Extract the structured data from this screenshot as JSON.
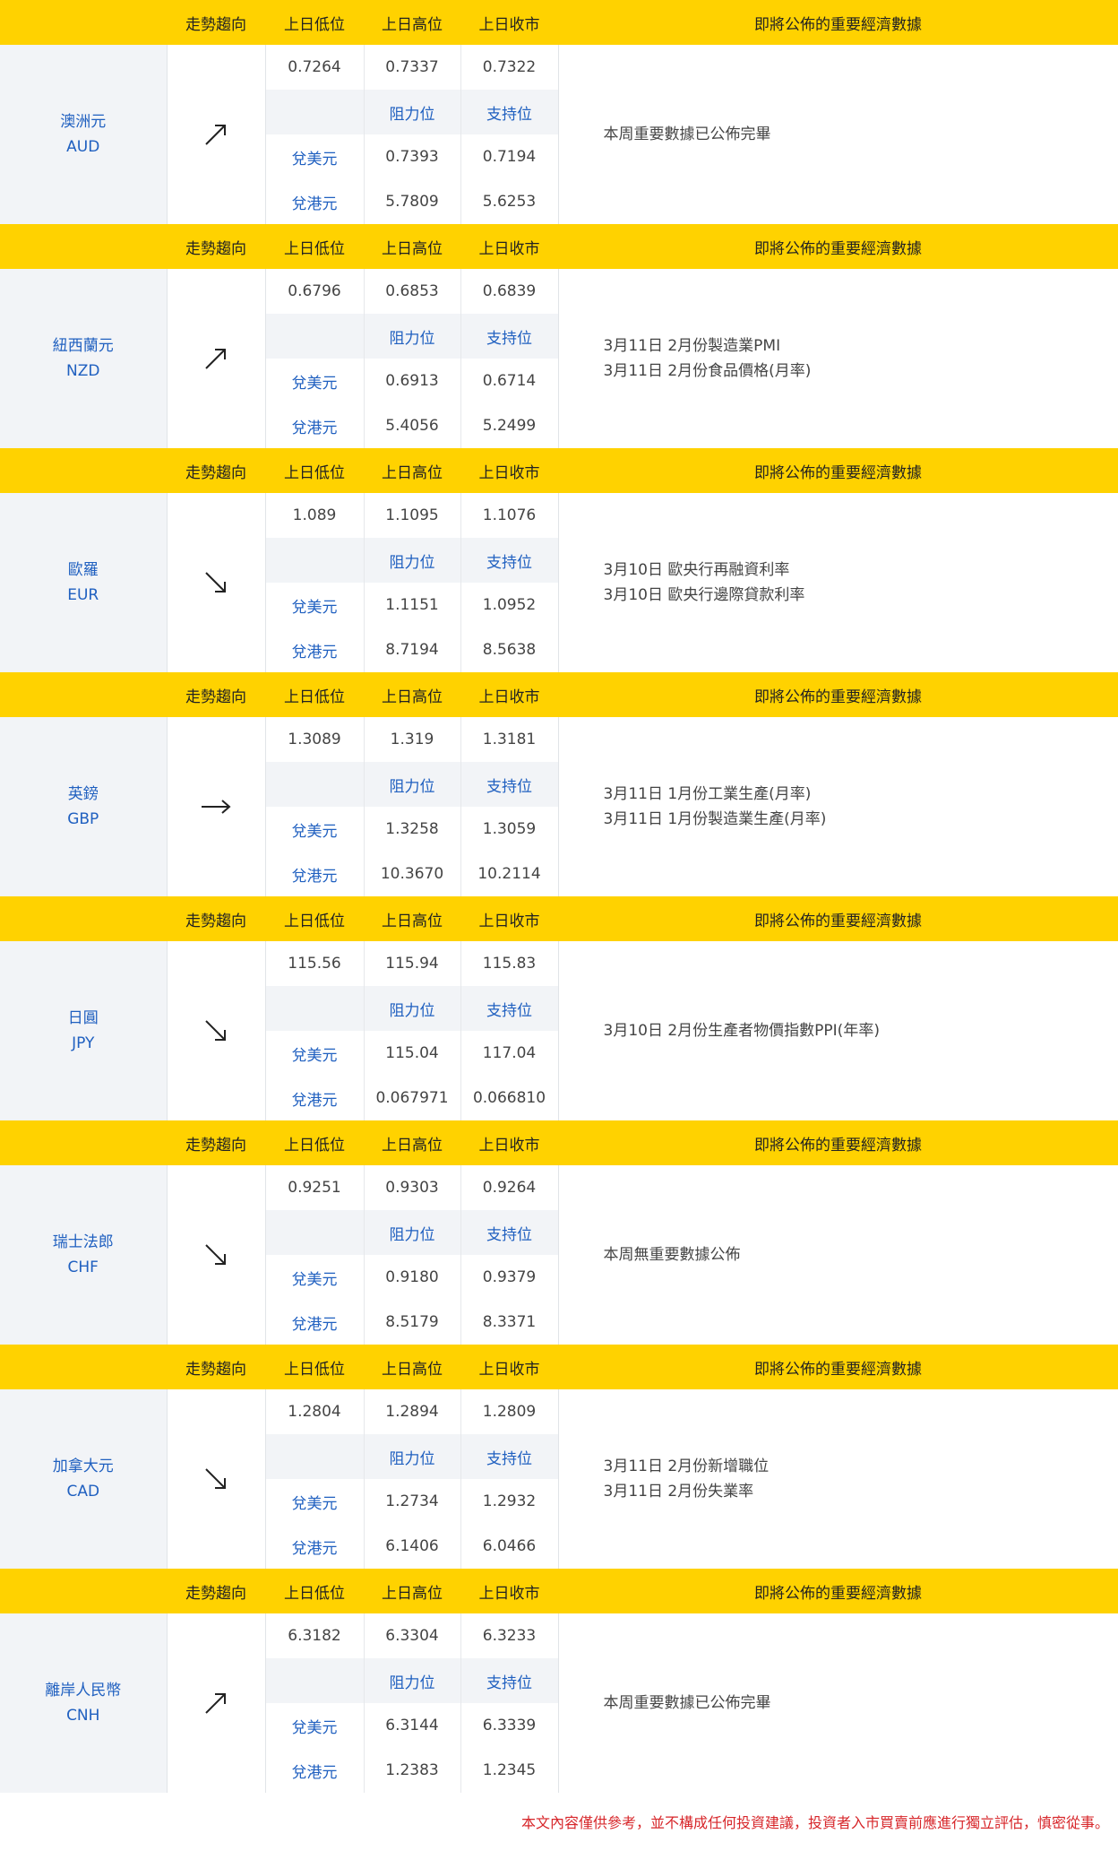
{
  "header": {
    "trend": "走勢趨向",
    "prev_low": "上日低位",
    "prev_high": "上日高位",
    "prev_close": "上日收市",
    "news": "即將公佈的重要經濟數據"
  },
  "sub_header": {
    "resistance": "阻力位",
    "support": "支持位"
  },
  "labels": {
    "vs_usd": "兌美元",
    "vs_hkd": "兌港元"
  },
  "currencies": [
    {
      "name": "澳洲元",
      "code": "AUD",
      "trend_icon": "arrow-up-right-icon",
      "prev_low": "0.7264",
      "prev_high": "0.7337",
      "prev_close": "0.7322",
      "usd_resistance": "0.7393",
      "usd_support": "0.7194",
      "hkd_resistance": "5.7809",
      "hkd_support": "5.6253",
      "news": [
        "本周重要數據已公佈完畢"
      ]
    },
    {
      "name": "紐西蘭元",
      "code": "NZD",
      "trend_icon": "arrow-up-right-icon",
      "prev_low": "0.6796",
      "prev_high": "0.6853",
      "prev_close": "0.6839",
      "usd_resistance": "0.6913",
      "usd_support": "0.6714",
      "hkd_resistance": "5.4056",
      "hkd_support": "5.2499",
      "news": [
        "3月11日 2月份製造業PMI",
        "3月11日 2月份食品價格(月率)"
      ]
    },
    {
      "name": "歐羅",
      "code": "EUR",
      "trend_icon": "arrow-down-right-icon",
      "prev_low": "1.089",
      "prev_high": "1.1095",
      "prev_close": "1.1076",
      "usd_resistance": "1.1151",
      "usd_support": "1.0952",
      "hkd_resistance": "8.7194",
      "hkd_support": "8.5638",
      "news": [
        "3月10日 歐央行再融資利率",
        "3月10日 歐央行邊際貸款利率"
      ]
    },
    {
      "name": "英鎊",
      "code": "GBP",
      "trend_icon": "arrow-right-icon",
      "prev_low": "1.3089",
      "prev_high": "1.319",
      "prev_close": "1.3181",
      "usd_resistance": "1.3258",
      "usd_support": "1.3059",
      "hkd_resistance": "10.3670",
      "hkd_support": "10.2114",
      "news": [
        "3月11日 1月份工業生產(月率)",
        "3月11日 1月份製造業生產(月率)"
      ]
    },
    {
      "name": "日圓",
      "code": "JPY",
      "trend_icon": "arrow-down-right-icon",
      "prev_low": "115.56",
      "prev_high": "115.94",
      "prev_close": "115.83",
      "usd_resistance": "115.04",
      "usd_support": "117.04",
      "hkd_resistance": "0.067971",
      "hkd_support": "0.066810",
      "news": [
        "3月10日 2月份生產者物價指數PPI(年率)"
      ]
    },
    {
      "name": "瑞士法郎",
      "code": "CHF",
      "trend_icon": "arrow-down-right-icon",
      "prev_low": "0.9251",
      "prev_high": "0.9303",
      "prev_close": "0.9264",
      "usd_resistance": "0.9180",
      "usd_support": "0.9379",
      "hkd_resistance": "8.5179",
      "hkd_support": "8.3371",
      "news": [
        "本周無重要數據公佈"
      ]
    },
    {
      "name": "加拿大元",
      "code": "CAD",
      "trend_icon": "arrow-down-right-icon",
      "prev_low": "1.2804",
      "prev_high": "1.2894",
      "prev_close": "1.2809",
      "usd_resistance": "1.2734",
      "usd_support": "1.2932",
      "hkd_resistance": "6.1406",
      "hkd_support": "6.0466",
      "news": [
        "3月11日 2月份新增職位",
        "3月11日 2月份失業率"
      ]
    },
    {
      "name": "離岸人民幣",
      "code": "CNH",
      "trend_icon": "arrow-up-right-icon",
      "prev_low": "6.3182",
      "prev_high": "6.3304",
      "prev_close": "6.3233",
      "usd_resistance": "6.3144",
      "usd_support": "6.3339",
      "hkd_resistance": "1.2383",
      "hkd_support": "1.2345",
      "news": [
        "本周重要數據已公佈完畢"
      ]
    }
  ],
  "disclaimer": "本文內容僅供參考，並不構成任何投資建議，投資者入市買賣前應進行獨立評估，慎密從事。"
}
